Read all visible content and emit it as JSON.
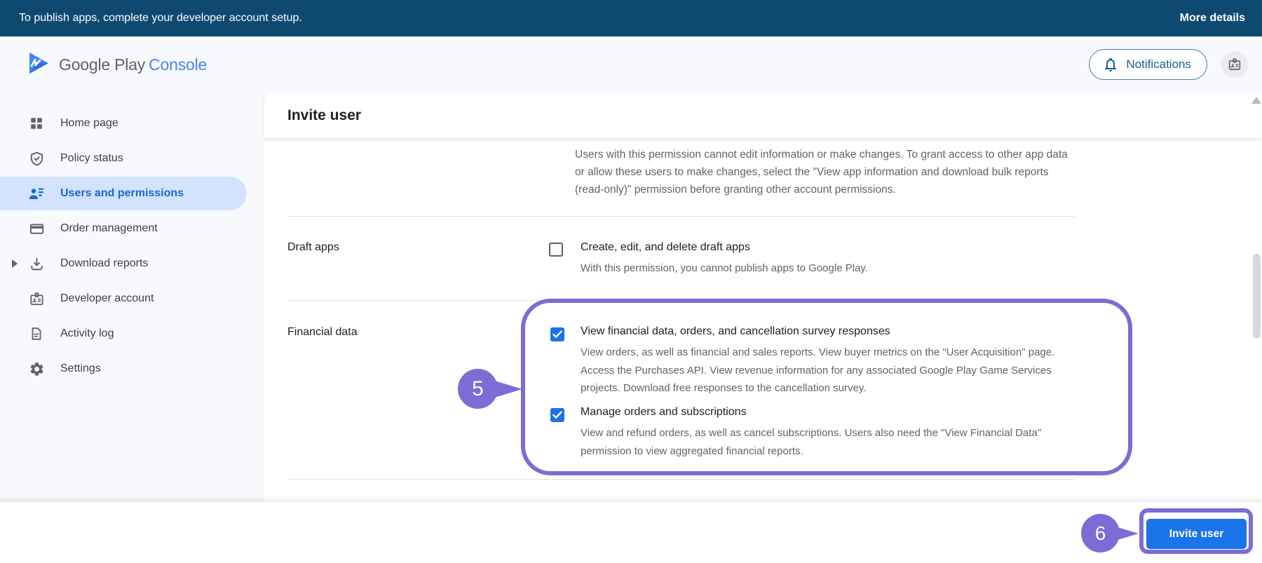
{
  "colors": {
    "banner_bg": "#0e4a70",
    "accent_blue": "#1a73e8",
    "selected_blue_bg": "#d3e3fd",
    "selected_blue_text": "#1967d2",
    "annotation_purple": "#7b6cd6",
    "text_dark": "#202124",
    "text_gray": "#5f6368"
  },
  "banner": {
    "message": "To publish apps, complete your developer account setup.",
    "action_label": "More details"
  },
  "header": {
    "brand": "Google Play",
    "brand_suffix": "Console",
    "notifications_label": "Notifications"
  },
  "sidebar": {
    "items": [
      {
        "label": "Home page",
        "icon": "grid-icon",
        "selected": false
      },
      {
        "label": "Policy status",
        "icon": "shield-check-icon",
        "selected": false
      },
      {
        "label": "Users and permissions",
        "icon": "users-icon",
        "selected": true
      },
      {
        "label": "Order management",
        "icon": "credit-card-icon",
        "selected": false
      },
      {
        "label": "Download reports",
        "icon": "download-icon",
        "selected": false,
        "collapsed_caret": true
      },
      {
        "label": "Developer account",
        "icon": "id-badge-icon",
        "selected": false
      },
      {
        "label": "Activity log",
        "icon": "document-icon",
        "selected": false
      },
      {
        "label": "Settings",
        "icon": "gear-icon",
        "selected": false
      }
    ]
  },
  "content": {
    "title": "Invite user",
    "intro": "Users with this permission cannot edit information or make changes. To grant access to other app data or allow these users to make changes, select the \"View app information and download bulk reports (read-only)\" permission before granting other account permissions.",
    "sections": [
      {
        "label": "Draft apps",
        "options": [
          {
            "title": "Create, edit, and delete draft apps",
            "checked": false,
            "description": "With this permission, you cannot publish apps to Google Play."
          }
        ]
      },
      {
        "label": "Financial data",
        "options": [
          {
            "title": "View financial data, orders, and cancellation survey responses",
            "checked": true,
            "description": "View orders, as well as financial and sales reports. View buyer metrics on the \"User Acquisition\" page. Access the Purchases API. View revenue information for any associated Google Play Game Services projects. Download free responses to the cancellation survey."
          },
          {
            "title": "Manage orders and subscriptions",
            "checked": true,
            "description": "View and refund orders, as well as cancel subscriptions. Users also need the \"View Financial Data\" permission to view aggregated financial reports."
          }
        ]
      }
    ]
  },
  "footer": {
    "invite_button_label": "Invite user"
  },
  "annotations": {
    "step_5": "5",
    "step_6": "6"
  }
}
